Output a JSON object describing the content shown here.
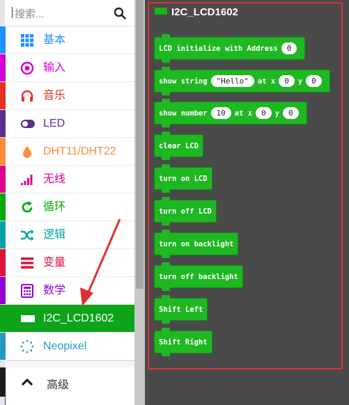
{
  "search": {
    "placeholder": "搜索..."
  },
  "categories": [
    {
      "label": "基本",
      "color": "#1e90ff",
      "icon": "grid-icon"
    },
    {
      "label": "输入",
      "color": "#d400d4",
      "icon": "target-icon"
    },
    {
      "label": "音乐",
      "color": "#e63022",
      "icon": "headphones-icon"
    },
    {
      "label": "LED",
      "color": "#5c2d91",
      "icon": "toggle-icon"
    },
    {
      "label": "DHT11/DHT22",
      "color": "#ff8c3a",
      "icon": "drop-icon"
    },
    {
      "label": "无线",
      "color": "#e3008c",
      "icon": "signal-icon"
    },
    {
      "label": "循环",
      "color": "#00aa00",
      "icon": "loop-icon"
    },
    {
      "label": "逻辑",
      "color": "#00a4a6",
      "icon": "shuffle-icon"
    },
    {
      "label": "变量",
      "color": "#dc143c",
      "icon": "lines-icon"
    },
    {
      "label": "数学",
      "color": "#9400d3",
      "icon": "calculator-icon"
    },
    {
      "label": "I2C_LCD1602",
      "color": "#0fa31a",
      "icon": "display-icon"
    },
    {
      "label": "Neopixel",
      "color": "#2699bf",
      "icon": "ring-icon"
    }
  ],
  "advanced": {
    "label": "高级"
  },
  "flyout": {
    "title": "I2C_LCD1602",
    "blocks": {
      "init": {
        "text": "LCD initialize with Address",
        "address": "0"
      },
      "show_string": {
        "t1": "show string",
        "value": "\"Hello\"",
        "t2": "at x",
        "x": "0",
        "t3": "y",
        "y": "0"
      },
      "show_number": {
        "t1": "show number",
        "value": "10",
        "t2": "at x",
        "x": "0",
        "t3": "y",
        "y": "0"
      },
      "clear": "clear LCD",
      "turn_on": "turn on LCD",
      "turn_off": "turn off LCD",
      "backlight_on": "turn on backlight",
      "backlight_off": "turn off backlight",
      "shift_left": "Shift Left",
      "shift_right": "Shift Right"
    }
  },
  "colors": {
    "accent_green": "#0fa31a",
    "highlight_red": "#e0302e",
    "workspace_bg": "#4a4a4a"
  }
}
